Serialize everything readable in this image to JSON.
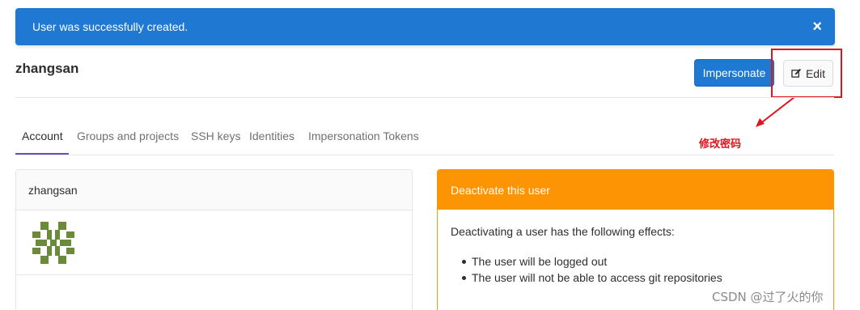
{
  "alert": {
    "message": "User was successfully created.",
    "close_glyph": "×"
  },
  "header": {
    "username": "zhangsan",
    "impersonate_label": "Impersonate",
    "edit_label": "Edit",
    "edit_icon": "pencil-square-icon"
  },
  "annotation": {
    "text": "修改密码",
    "color": "#e0141e"
  },
  "tabs": [
    {
      "label": "Account",
      "active": true
    },
    {
      "label": "Groups and projects",
      "active": false
    },
    {
      "label": "SSH keys",
      "active": false
    },
    {
      "label": "Identities",
      "active": false
    },
    {
      "label": "Impersonation Tokens",
      "active": false
    }
  ],
  "profile_card": {
    "name": "zhangsan",
    "avatar_icon": "identicon-avatar"
  },
  "deactivate_card": {
    "title": "Deactivate this user",
    "intro": "Deactivating a user has the following effects:",
    "effects": [
      "The user will be logged out",
      "The user will not be able to access git repositories"
    ]
  },
  "watermark": "CSDN @过了火的你",
  "colors": {
    "primary": "#1f78d1",
    "warning": "#fc9403",
    "tab_active": "#6b4fbb",
    "annotation": "#e0141e"
  }
}
